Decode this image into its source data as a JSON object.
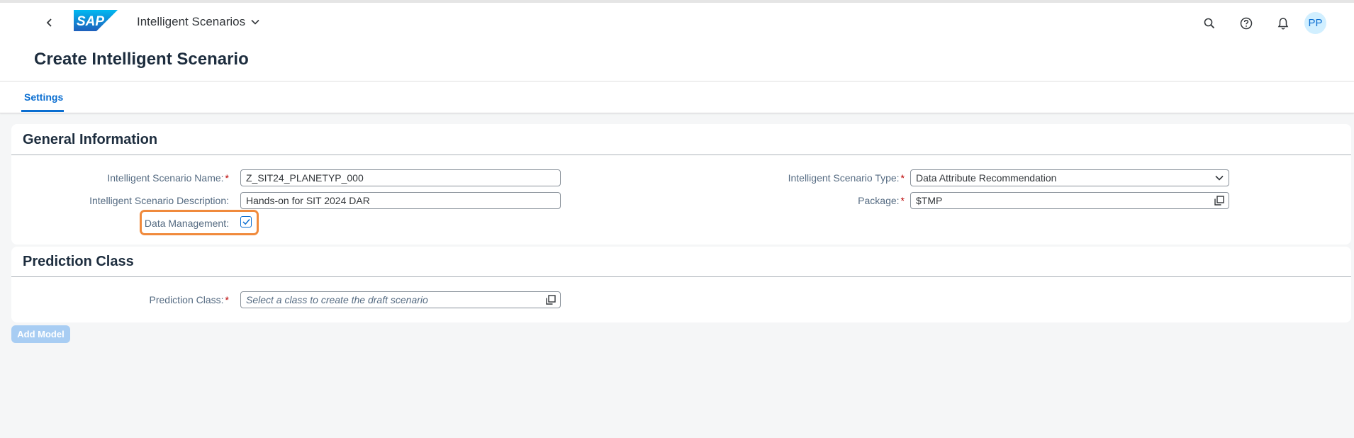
{
  "shell": {
    "logo_text": "SAP",
    "app_title": "Intelligent Scenarios",
    "avatar_initials": "PP",
    "icons": [
      "back-icon",
      "search-icon",
      "help-icon",
      "notification-icon",
      "chevron-down-icon"
    ]
  },
  "page": {
    "title": "Create Intelligent Scenario"
  },
  "tabs": [
    {
      "label": "Settings",
      "selected": true
    }
  ],
  "general_information": {
    "title": "General Information",
    "scenario_name": {
      "label": "Intelligent Scenario Name:",
      "required": "*",
      "value": "Z_SIT24_PLANETYP_000"
    },
    "scenario_description": {
      "label": "Intelligent Scenario Description:",
      "value": "Hands-on for SIT 2024 DAR"
    },
    "data_management": {
      "label": "Data Management:",
      "checked": true
    },
    "scenario_type": {
      "label": "Intelligent Scenario Type:",
      "required": "*",
      "value": "Data Attribute Recommendation"
    },
    "package": {
      "label": "Package:",
      "required": "*",
      "value": "$TMP"
    }
  },
  "prediction_class": {
    "title": "Prediction Class",
    "field": {
      "label": "Prediction Class:",
      "required": "*",
      "placeholder": "Select a class to create the draft scenario"
    }
  },
  "buttons": {
    "add_model": "Add Model"
  },
  "colors": {
    "brand_blue": "#0a6ed1",
    "highlight_orange": "#f08a3c",
    "required_red": "#bb0000",
    "disabled_button": "#a8cdf3"
  }
}
